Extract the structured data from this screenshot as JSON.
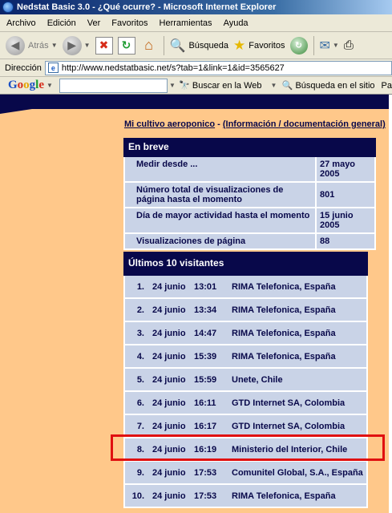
{
  "window": {
    "title": "Nedstat Basic 3.0 - ¿Qué ocurre? - Microsoft Internet Explorer"
  },
  "menu": [
    "Archivo",
    "Edición",
    "Ver",
    "Favoritos",
    "Herramientas",
    "Ayuda"
  ],
  "toolbar": {
    "back_label": "Atrás",
    "search_label": "Búsqueda",
    "favorites_label": "Favoritos"
  },
  "address": {
    "label": "Dirección",
    "url": "http://www.nedstatbasic.net/s?tab=1&link=1&id=3565627"
  },
  "googlebar": {
    "logo": "Google",
    "search_web_label": "Buscar en la Web",
    "site_search_label": "Búsqueda en el sitio",
    "truncated": "Pa"
  },
  "links": {
    "site_name": "Mi cultivo aeroponico",
    "separator": " - ",
    "info": "(Información / documentación general)"
  },
  "summary": {
    "title": "En breve",
    "rows": [
      {
        "label": "Medir desde ...",
        "value": "27 mayo 2005"
      },
      {
        "label": "Número total de visualizaciones de página hasta el momento",
        "value": "801"
      },
      {
        "label": "Día de mayor actividad hasta el momento",
        "value": "15 junio 2005"
      },
      {
        "label": "Visualizaciones de página",
        "value": "88"
      }
    ]
  },
  "visitors": {
    "title": "Últimos 10 visitantes",
    "rows": [
      {
        "num": "1.",
        "date": "24 junio",
        "time": "13:01",
        "isp": "RIMA Telefonica, España"
      },
      {
        "num": "2.",
        "date": "24 junio",
        "time": "13:34",
        "isp": "RIMA Telefonica, España"
      },
      {
        "num": "3.",
        "date": "24 junio",
        "time": "14:47",
        "isp": "RIMA Telefonica, España"
      },
      {
        "num": "4.",
        "date": "24 junio",
        "time": "15:39",
        "isp": "RIMA Telefonica, España"
      },
      {
        "num": "5.",
        "date": "24 junio",
        "time": "15:59",
        "isp": "Unete, Chile"
      },
      {
        "num": "6.",
        "date": "24 junio",
        "time": "16:11",
        "isp": "GTD Internet SA, Colombia"
      },
      {
        "num": "7.",
        "date": "24 junio",
        "time": "16:17",
        "isp": "GTD Internet SA, Colombia"
      },
      {
        "num": "8.",
        "date": "24 junio",
        "time": "16:19",
        "isp": "Ministerio del Interior, Chile"
      },
      {
        "num": "9.",
        "date": "24 junio",
        "time": "17:53",
        "isp": "Comunitel Global, S.A., España"
      },
      {
        "num": "10.",
        "date": "24 junio",
        "time": "17:53",
        "isp": "RIMA Telefonica, España"
      }
    ]
  },
  "colors": {
    "page_bg": "#ffc88a",
    "navy": "#08084a",
    "row_bg": "#c9d3e7",
    "highlight": "#e01010"
  }
}
